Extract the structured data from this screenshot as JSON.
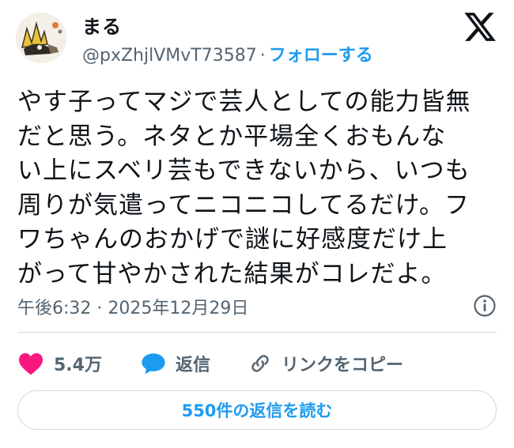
{
  "author": {
    "display_name": "まる",
    "handle": "@pxZhjlVMvT73587",
    "follow_label": "フォローする"
  },
  "tweet": {
    "text": "やす子ってマジで芸人としての能力皆無\nだと思う。ネタとか平場全くおもんな\nい上にスベリ芸もできないから、いつも\n周りが気遣ってニコニコしてるだけ。フ\nワちゃんのおかげで謎に好感度だけ上\nがって甘やかされた結果がコレだよ。",
    "timestamp": "午後6:32 · 2025年12月29日"
  },
  "actions": {
    "likes": "5.4万",
    "reply_label": "返信",
    "copy_link_label": "リンクをコピー"
  },
  "replies_button_label": "550件の返信を読む",
  "colors": {
    "accent": "#1d9bf0",
    "like": "#f91880",
    "muted_text": "#536471",
    "border": "#cfd9de"
  },
  "icons": [
    "x-logo-icon",
    "info-icon",
    "heart-icon",
    "reply-bubble-icon",
    "link-icon"
  ]
}
